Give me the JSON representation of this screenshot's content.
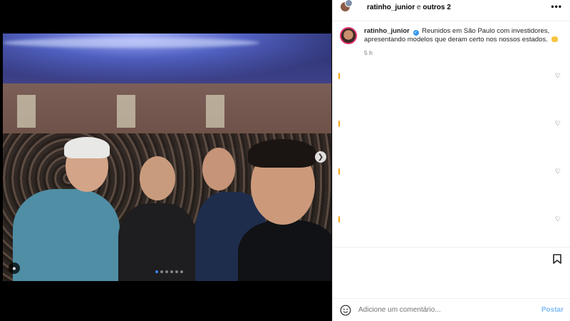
{
  "header": {
    "username": "ratinho_junior",
    "separator": " e ",
    "others": "outros 2",
    "more_icon": "more-horizontal-icon"
  },
  "caption": {
    "username": "ratinho_junior",
    "verified_icon": "verified-badge-icon",
    "text": "Reunidos em São Paulo com investidores, apresentando modelos que deram certo nos nossos estados.",
    "emoji_icon": "flexed-biceps-emoji",
    "time": "5 h"
  },
  "media": {
    "carousel_next_icon": "chevron-right-icon",
    "tag_icon": "user-tag-icon",
    "carousel_total": 6,
    "carousel_active_index": 0
  },
  "comments": {
    "heart_icon": "heart-outline-icon",
    "rows": 4
  },
  "actions": {
    "save_icon": "bookmark-icon"
  },
  "comment_bar": {
    "emoji_icon": "smiley-icon",
    "placeholder": "Adicione um comentário...",
    "post_label": "Postar",
    "post_color": "#7fbbf5"
  },
  "colors": {
    "verified": "#3897f0",
    "accent": "#3b82f6",
    "muted": "#737373"
  }
}
